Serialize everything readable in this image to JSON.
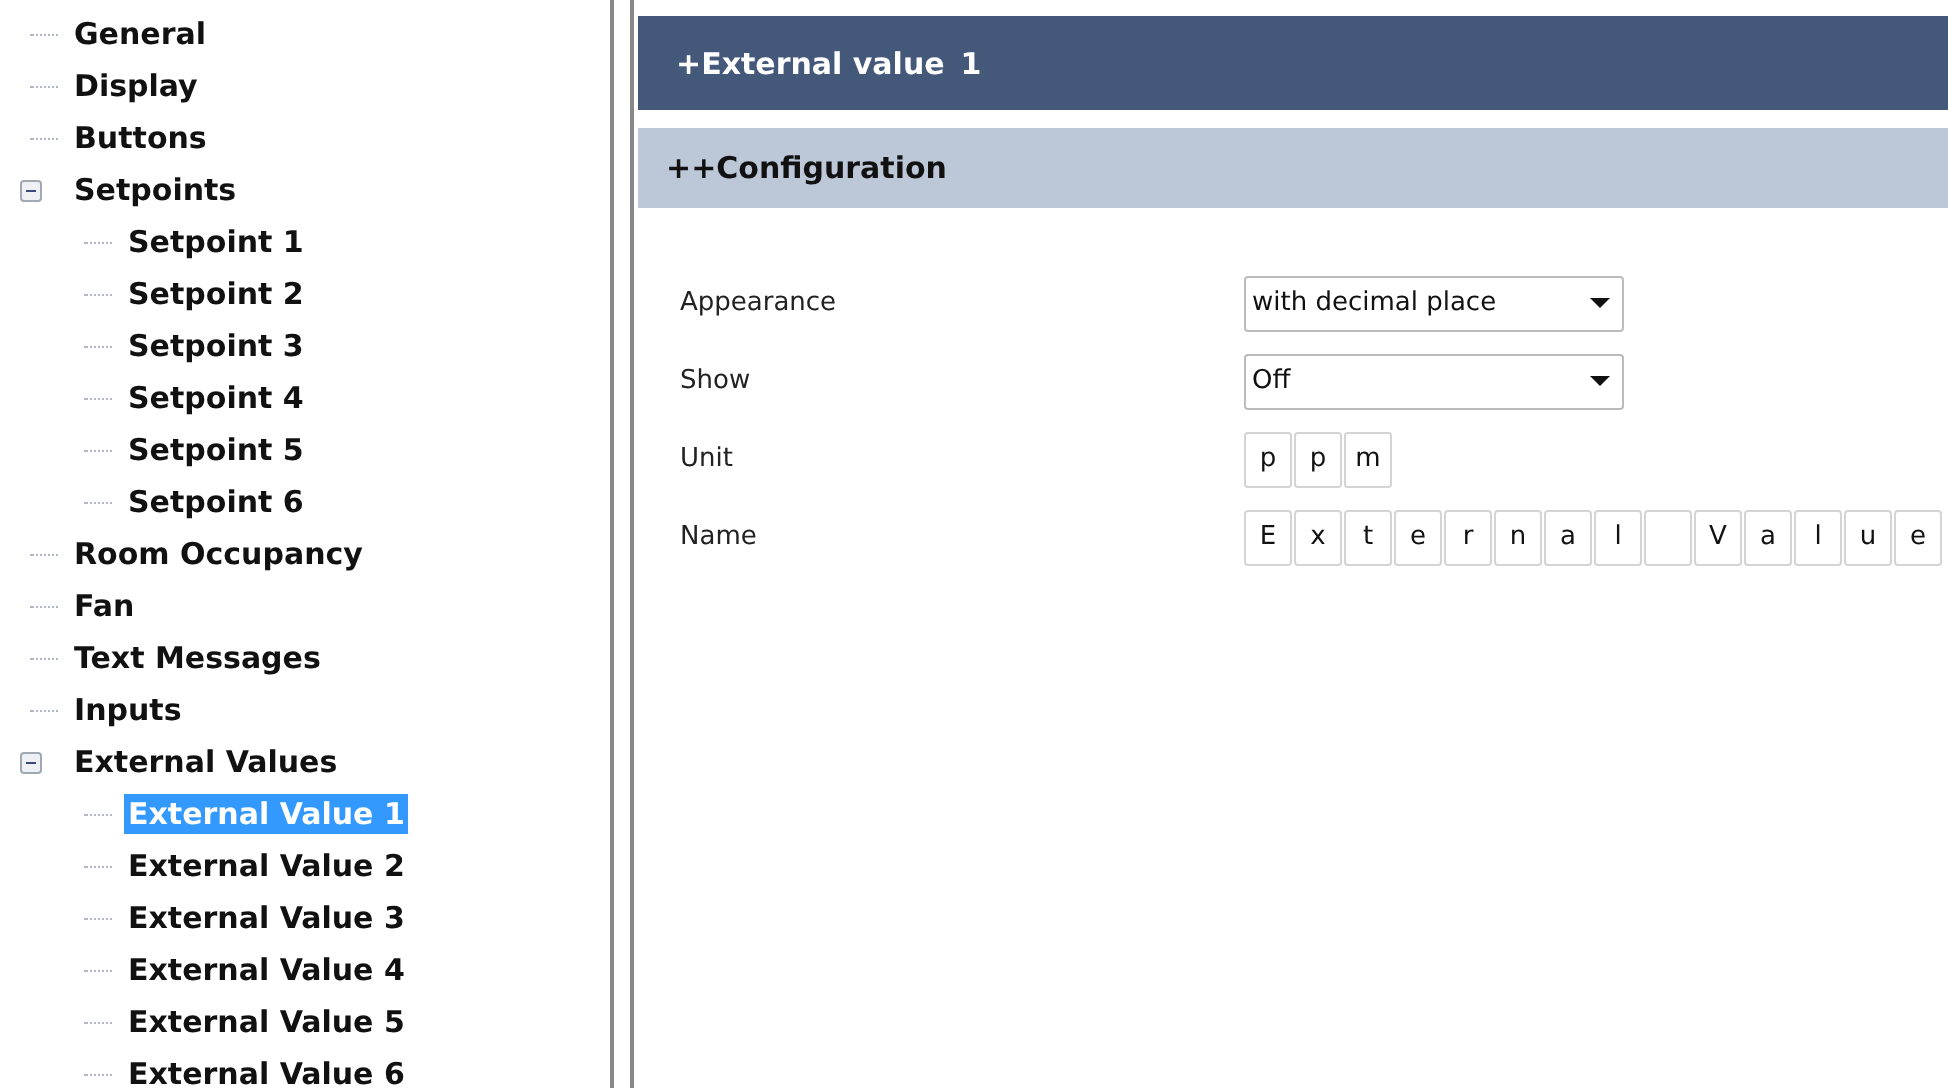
{
  "tree": [
    {
      "label": "General"
    },
    {
      "label": "Display"
    },
    {
      "label": "Buttons"
    },
    {
      "label": "Setpoints",
      "expanded": true,
      "children": [
        {
          "label": "Setpoint 1",
          "selected": false
        },
        {
          "label": "Setpoint 2",
          "selected": false
        },
        {
          "label": "Setpoint 3",
          "selected": false
        },
        {
          "label": "Setpoint 4",
          "selected": false
        },
        {
          "label": "Setpoint 5",
          "selected": false
        },
        {
          "label": "Setpoint 6",
          "selected": false
        }
      ]
    },
    {
      "label": "Room Occupancy"
    },
    {
      "label": "Fan"
    },
    {
      "label": "Text Messages"
    },
    {
      "label": "Inputs"
    },
    {
      "label": "External Values",
      "expanded": true,
      "children": [
        {
          "label": "External Value 1",
          "selected": true
        },
        {
          "label": "External Value 2",
          "selected": false
        },
        {
          "label": "External Value 3",
          "selected": false
        },
        {
          "label": "External Value 4",
          "selected": false
        },
        {
          "label": "External Value 5",
          "selected": false
        },
        {
          "label": "External Value 6",
          "selected": false
        }
      ]
    }
  ],
  "header": {
    "title": "+External value",
    "number": "1"
  },
  "section": {
    "title": "++Configuration"
  },
  "fields": [
    {
      "kind": "dropdown",
      "label": "Appearance",
      "value": "with decimal place"
    },
    {
      "kind": "dropdown",
      "label": "Show",
      "value": "Off"
    },
    {
      "kind": "chars",
      "label": "Unit",
      "cells": [
        {
          "kind": "char",
          "text": "p"
        },
        {
          "kind": "char",
          "text": "p"
        },
        {
          "kind": "char",
          "text": "m"
        }
      ]
    },
    {
      "kind": "chars",
      "label": "Name",
      "cells": [
        {
          "kind": "char",
          "text": "E"
        },
        {
          "kind": "char",
          "text": "x"
        },
        {
          "kind": "char",
          "text": "t"
        },
        {
          "kind": "char",
          "text": "e"
        },
        {
          "kind": "char",
          "text": "r"
        },
        {
          "kind": "char",
          "text": "n"
        },
        {
          "kind": "char",
          "text": "a"
        },
        {
          "kind": "char",
          "text": "l"
        },
        {
          "kind": "blank"
        },
        {
          "kind": "char",
          "text": "V"
        },
        {
          "kind": "char",
          "text": "a"
        },
        {
          "kind": "char",
          "text": "l"
        },
        {
          "kind": "char",
          "text": "u"
        },
        {
          "kind": "char",
          "text": "e"
        }
      ]
    }
  ]
}
